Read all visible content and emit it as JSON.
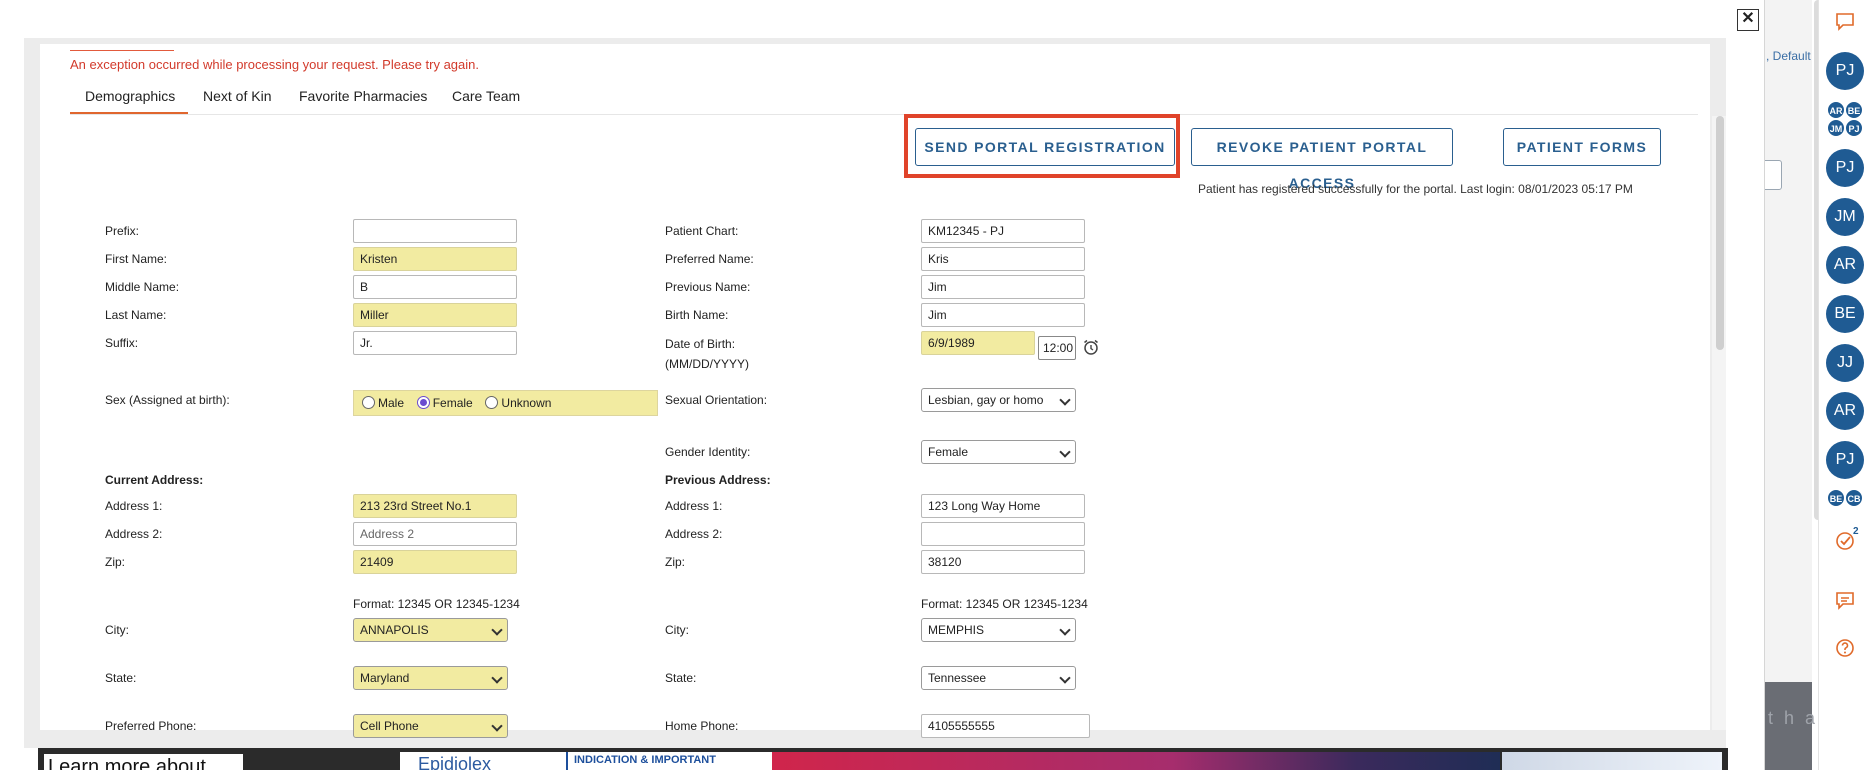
{
  "error_message": "An exception occurred while processing your request. Please try again.",
  "tabs": [
    "Demographics",
    "Next of Kin",
    "Favorite Pharmacies",
    "Care Team"
  ],
  "buttons": {
    "send_portal": "SEND PORTAL REGISTRATION",
    "revoke_portal": "REVOKE PATIENT PORTAL ACCESS",
    "patient_forms": "PATIENT FORMS"
  },
  "portal_status": "Patient has registered successfully for the portal. Last login: 08/01/2023 05:17 PM",
  "left_fields": {
    "prefix": {
      "label": "Prefix:",
      "value": ""
    },
    "first_name": {
      "label": "First Name:",
      "value": "Kristen"
    },
    "middle_name": {
      "label": "Middle Name:",
      "value": "B"
    },
    "last_name": {
      "label": "Last Name:",
      "value": "Miller"
    },
    "suffix": {
      "label": "Suffix:",
      "value": "Jr."
    },
    "sex": {
      "label": "Sex (Assigned at birth):",
      "options": [
        "Male",
        "Female",
        "Unknown"
      ],
      "selected": "Female"
    }
  },
  "right_fields": {
    "patient_chart": {
      "label": "Patient Chart:",
      "value": "KM12345 - PJ"
    },
    "preferred_name": {
      "label": "Preferred Name:",
      "value": "Kris"
    },
    "previous_name": {
      "label": "Previous Name:",
      "value": "Jim"
    },
    "birth_name": {
      "label": "Birth Name:",
      "value": "Jim"
    },
    "dob": {
      "label": "Date of Birth:",
      "sublabel": "(MM/DD/YYYY)",
      "value": "6/9/1989",
      "time": "12:00"
    },
    "sexual_orientation": {
      "label": "Sexual Orientation:",
      "value": "Lesbian, gay or homo"
    },
    "gender_identity": {
      "label": "Gender Identity:",
      "value": "Female"
    }
  },
  "current_address": {
    "heading": "Current Address:",
    "address1": {
      "label": "Address 1:",
      "value": "213 23rd Street No.1"
    },
    "address2": {
      "label": "Address 2:",
      "value": "",
      "placeholder": "Address 2"
    },
    "zip": {
      "label": "Zip:",
      "value": "21409"
    },
    "format": "Format: 12345 OR 12345-1234",
    "city": {
      "label": "City:",
      "value": "ANNAPOLIS"
    },
    "state": {
      "label": "State:",
      "value": "Maryland"
    },
    "phone": {
      "label": "Preferred Phone:",
      "value": "Cell Phone"
    }
  },
  "previous_address": {
    "heading": "Previous Address:",
    "address1": {
      "label": "Address 1:",
      "value": "123 Long Way Home"
    },
    "address2": {
      "label": "Address 2:",
      "value": ""
    },
    "zip": {
      "label": "Zip:",
      "value": "38120"
    },
    "format": "Format: 12345 OR 12345-1234",
    "city": {
      "label": "City:",
      "value": "MEMPHIS"
    },
    "state": {
      "label": "State:",
      "value": "Tennessee"
    },
    "phone": {
      "label": "Home Phone:",
      "value": "4105555555"
    }
  },
  "banner": {
    "learn": "Learn more about",
    "logo": "Epidiolex",
    "indication": "INDICATION & IMPORTANT"
  },
  "background": {
    "default_link": ", Default",
    "dark_text": "t h a"
  },
  "sidebar": {
    "avatars_top": [
      "PJ"
    ],
    "mini_group_1": [
      "AR",
      "BE",
      "JM",
      "PJ"
    ],
    "avatars": [
      "PJ",
      "JM",
      "AR",
      "BE",
      "JJ",
      "AR",
      "PJ"
    ],
    "mini_group_2": [
      "BE",
      "CB"
    ],
    "task_badge": "2"
  },
  "colors": {
    "accent_blue": "#2a5f8f",
    "avatar_blue": "#1f5b93",
    "required_yellow": "#f2eba1",
    "error_red": "#d23a2b",
    "highlight_red": "#e0432a",
    "tab_orange": "#e0662e"
  }
}
